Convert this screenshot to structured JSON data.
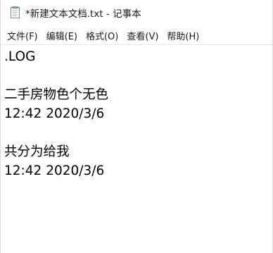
{
  "window": {
    "title": "*新建文本文档.txt - 记事本",
    "icon": "notepad-icon"
  },
  "menubar": {
    "items": [
      {
        "label": "文件(F)"
      },
      {
        "label": "编辑(E)"
      },
      {
        "label": "格式(O)"
      },
      {
        "label": "查看(V)"
      },
      {
        "label": "帮助(H)"
      }
    ]
  },
  "editor": {
    "lines": [
      ".LOG",
      "",
      "二手房物色个无色",
      "12:42 2020/3/6",
      "",
      "共分为给我",
      "12:42 2020/3/6"
    ]
  }
}
